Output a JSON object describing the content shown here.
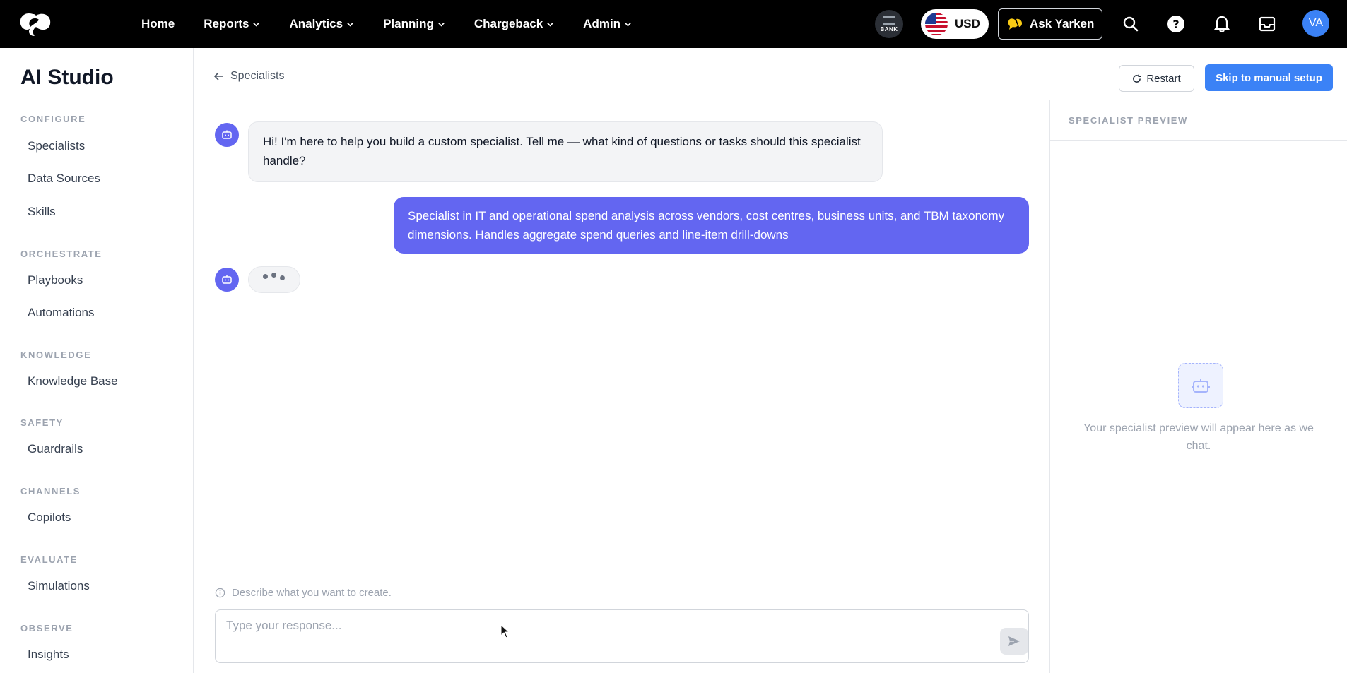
{
  "topnav": {
    "items": [
      {
        "label": "Home",
        "has_menu": false
      },
      {
        "label": "Reports",
        "has_menu": true
      },
      {
        "label": "Analytics",
        "has_menu": true
      },
      {
        "label": "Planning",
        "has_menu": true
      },
      {
        "label": "Chargeback",
        "has_menu": true
      },
      {
        "label": "Admin",
        "has_menu": true
      }
    ],
    "bank_badge": "BANK",
    "currency": "USD",
    "ask_button": "Ask Yarken",
    "avatar_initials": "VA",
    "icons": [
      "search-icon",
      "help-icon",
      "bell-icon",
      "inbox-icon"
    ]
  },
  "sidebar": {
    "title": "AI Studio",
    "sections": [
      {
        "label": "CONFIGURE",
        "items": [
          "Specialists",
          "Data Sources",
          "Skills"
        ]
      },
      {
        "label": "ORCHESTRATE",
        "items": [
          "Playbooks",
          "Automations"
        ]
      },
      {
        "label": "KNOWLEDGE",
        "items": [
          "Knowledge Base"
        ]
      },
      {
        "label": "SAFETY",
        "items": [
          "Guardrails"
        ]
      },
      {
        "label": "CHANNELS",
        "items": [
          "Copilots"
        ]
      },
      {
        "label": "EVALUATE",
        "items": [
          "Simulations"
        ]
      },
      {
        "label": "OBSERVE",
        "items": [
          "Insights"
        ]
      }
    ]
  },
  "header": {
    "back_label": "Specialists",
    "restart_label": "Restart",
    "skip_label": "Skip to manual setup"
  },
  "chat": {
    "messages": [
      {
        "role": "assistant",
        "text": "Hi! I'm here to help you build a custom specialist. Tell me — what kind of questions or tasks should this specialist handle?"
      },
      {
        "role": "user",
        "text": "Specialist in IT and operational spend analysis across vendors, cost centres, business units, and TBM taxonomy dimensions. Handles aggregate spend queries and line-item drill-downs"
      }
    ],
    "typing": true
  },
  "composer": {
    "hint": "Describe what you want to create.",
    "placeholder": "Type your response...",
    "value": ""
  },
  "preview": {
    "title": "SPECIALIST PREVIEW",
    "empty_text": "Your specialist preview will appear here as we chat."
  },
  "colors": {
    "accent": "#6366f1",
    "primary_button": "#3b82f6",
    "topbar": "#000000"
  }
}
